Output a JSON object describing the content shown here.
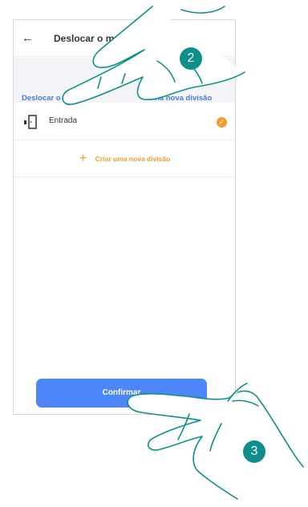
{
  "header": {
    "back_icon": "arrow-left-icon",
    "title": "Deslocar o m"
  },
  "banner": {
    "text_left": "Deslocar o disp",
    "text_right": "na nova divisão"
  },
  "rooms": [
    {
      "label": "Entrada",
      "icon": "door-icon",
      "selected": true
    }
  ],
  "create": {
    "icon": "plus-icon",
    "label": "Criar uma nova divisão"
  },
  "footer": {
    "confirm_label": "Confirmar"
  },
  "steps": [
    "2",
    "3"
  ],
  "colors": {
    "accent_blue": "#4f86f7",
    "accent_orange": "#f39b2c",
    "hand_teal": "#0f8f8c"
  }
}
